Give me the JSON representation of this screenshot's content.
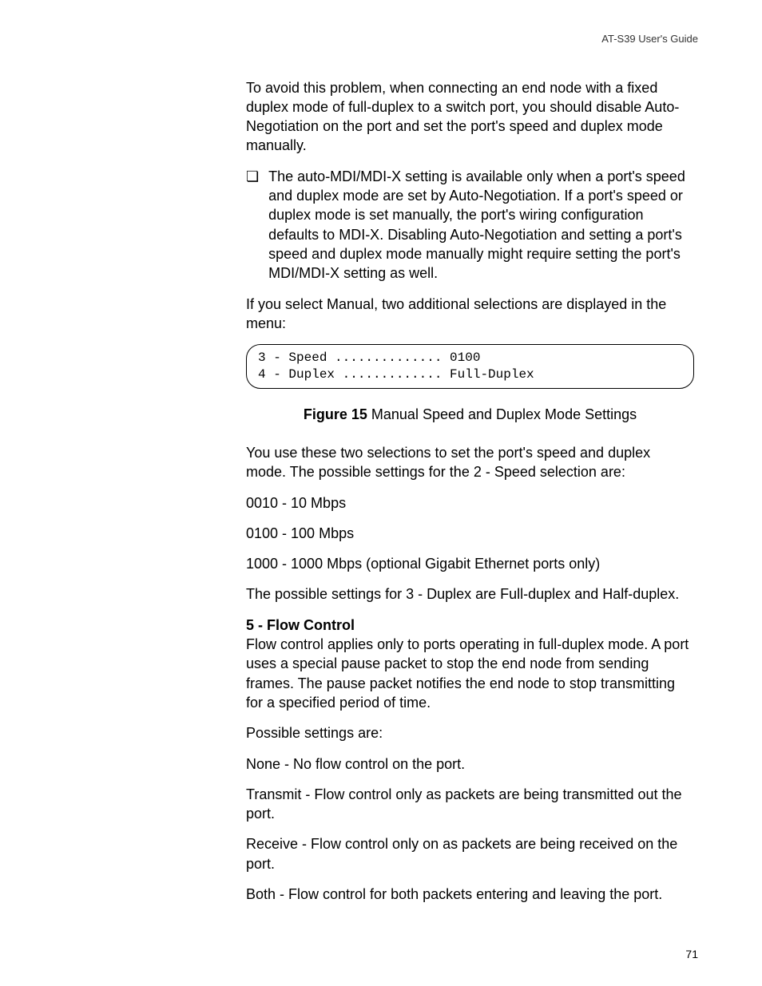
{
  "header": {
    "doc_title": "AT-S39 User's Guide"
  },
  "paragraphs": {
    "p1": "To avoid this problem, when connecting an end node with a fixed duplex mode of full-duplex to a switch port, you should disable Auto-Negotiation on the port and set the port's speed and duplex mode manually.",
    "bullet1": "The auto-MDI/MDI-X setting is available only when a port's speed and duplex mode are set by Auto-Negotiation. If a port's speed or duplex mode is set manually, the port's wiring configuration defaults to MDI-X. Disabling Auto-Negotiation and setting a port's speed and duplex mode manually might require setting the port's MDI/MDI-X setting as well.",
    "p2": "If you select Manual, two additional selections are displayed in the menu:",
    "codebox": "3 - Speed .............. 0100\n4 - Duplex ............. Full-Duplex",
    "fig_label": "Figure 15",
    "fig_caption": "  Manual Speed and Duplex Mode Settings",
    "p3": "You use these two selections to set the port's speed and duplex mode. The possible settings for the 2 - Speed selection are:",
    "speed_1": "0010 - 10 Mbps",
    "speed_2": "0100 - 100 Mbps",
    "speed_3": "1000 - 1000 Mbps (optional Gigabit Ethernet ports only)",
    "p4": "The possible settings for 3 - Duplex are Full-duplex and Half-duplex.",
    "heading_5": "5 - Flow Control",
    "p5": "Flow control applies only to ports operating in full-duplex mode. A port uses a special pause packet to stop the end node from sending frames. The pause packet notifies the end node to stop transmitting for a specified period of time.",
    "p6": "Possible settings are:",
    "fc_none": "None - No flow control on the port.",
    "fc_transmit": "Transmit - Flow control only as packets are being transmitted out the port.",
    "fc_receive": "Receive - Flow control only on as packets are being received on the port.",
    "fc_both": "Both - Flow control for both packets entering and leaving the port."
  },
  "page_number": "71"
}
